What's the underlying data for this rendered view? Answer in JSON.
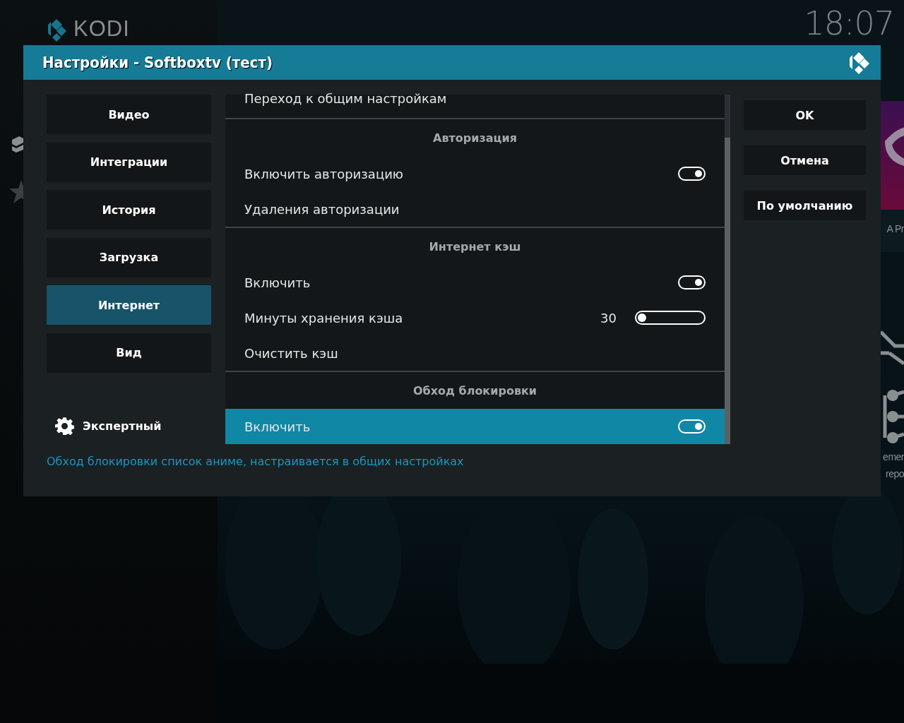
{
  "top_bar": {
    "logo": "KODI",
    "time": "18:07"
  },
  "background": {
    "peek_texts": [
      "A Pr",
      "emer",
      "repo"
    ]
  },
  "dialog": {
    "title": "Настройки - Softboxtv (тест)",
    "categories": [
      {
        "label": "Видео",
        "selected": false
      },
      {
        "label": "Интеграции",
        "selected": false
      },
      {
        "label": "История",
        "selected": false
      },
      {
        "label": "Загрузка",
        "selected": false
      },
      {
        "label": "Интернет",
        "selected": true
      },
      {
        "label": "Вид",
        "selected": false
      }
    ],
    "level_button": {
      "label": "Экспертный"
    },
    "groups": [
      {
        "items": [
          {
            "kind": "action",
            "label": "Переход к общим настройкам",
            "selected": false
          }
        ]
      },
      {
        "title": "Авторизация",
        "items": [
          {
            "kind": "toggle",
            "label": "Включить авторизацию",
            "on": true,
            "selected": false
          },
          {
            "kind": "action",
            "label": "Удаления авторизации",
            "selected": false
          }
        ]
      },
      {
        "title": "Интернет кэш",
        "items": [
          {
            "kind": "toggle",
            "label": "Включить",
            "on": true,
            "selected": false
          },
          {
            "kind": "slider",
            "label": "Минуты хранения кэша",
            "value": "30",
            "level": 0,
            "selected": false
          },
          {
            "kind": "action",
            "label": "Очистить кэш",
            "selected": false
          }
        ]
      },
      {
        "title": "Обход блокировки",
        "items": [
          {
            "kind": "toggle",
            "label": "Включить",
            "on": true,
            "selected": true
          }
        ]
      }
    ],
    "buttons": [
      {
        "label": "OK"
      },
      {
        "label": "Отмена"
      },
      {
        "label": "По умолчанию"
      }
    ],
    "description": "Обход блокировки список аниме, настраивается в общих настройках"
  }
}
